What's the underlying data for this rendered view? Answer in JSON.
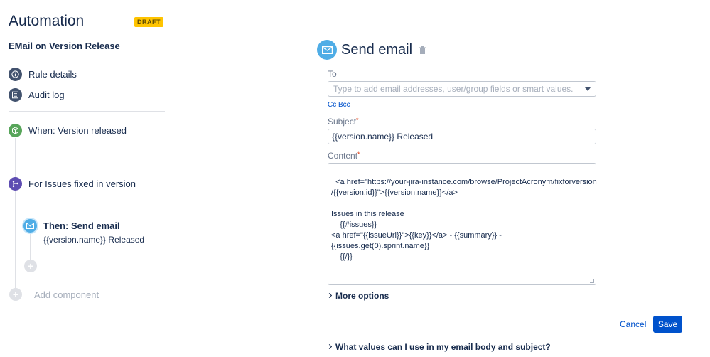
{
  "app": {
    "title": "Automation",
    "status_badge": "DRAFT"
  },
  "rule": {
    "name": "EMail on Version Release"
  },
  "nav": [
    {
      "label": "Rule details",
      "icon": "info-icon"
    },
    {
      "label": "Audit log",
      "icon": "list-icon"
    }
  ],
  "steps": {
    "trigger": {
      "label": "When: Version released",
      "icon": "cube-icon",
      "color": "#57a55a"
    },
    "branch": {
      "label": "For Issues fixed in version",
      "icon": "branch-icon",
      "color": "#5e4db2"
    },
    "action": {
      "label": "Then: Send email",
      "sub": "{{version.name}} Released",
      "icon": "envelope-icon",
      "color": "#4fade6"
    },
    "add_component": "Add component"
  },
  "panel": {
    "title": "Send email",
    "to": {
      "label": "To",
      "placeholder": "Type to add email addresses, user/group fields or smart values."
    },
    "cc_bcc": "Cc Bcc",
    "subject": {
      "label": "Subject",
      "required_mark": "*",
      "value": "{{version.name}} Released"
    },
    "content": {
      "label": "Content",
      "required_mark": "*",
      "value": "<a href=\"https://your-jira-instance.com/browse/ProjectAcronym/fixforversion\n/{{version.id}}\">{{version.name}}</a>\n\nIssues in this release\n    {{#issues}}\n<a href=\"{{issueUrl}}\">{{key}}</a> - {{summary}} -\n{{issues.get(0).sprint.name}}\n    {{/}}"
    },
    "more_options": "More options",
    "cancel": "Cancel",
    "save": "Save",
    "help": "What values can I use in my email body and subject?"
  },
  "colors": {
    "accent": "#0052cc",
    "badge": "#ffc400"
  }
}
